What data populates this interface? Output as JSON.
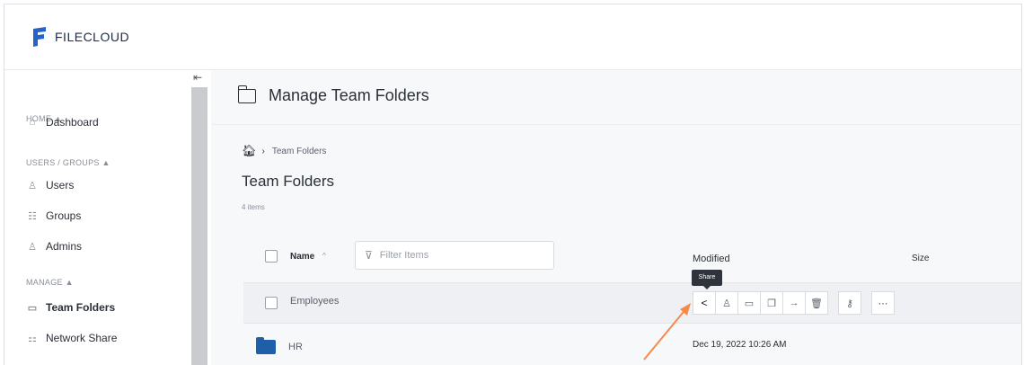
{
  "app": {
    "name": "FILECLOUD",
    "accent": "#2563c9",
    "arrow_color": "#f58a4a"
  },
  "sidebar": {
    "sections": [
      {
        "label": "HOME ▲"
      },
      {
        "label": "USERS / GROUPS ▲"
      },
      {
        "label": "MANAGE ▲"
      }
    ],
    "items": [
      {
        "label": "Dashboard",
        "icon": "home-icon"
      },
      {
        "label": "Users",
        "icon": "user-icon"
      },
      {
        "label": "Groups",
        "icon": "groups-icon"
      },
      {
        "label": "Admins",
        "icon": "admin-icon"
      },
      {
        "label": "Team Folders",
        "icon": "folder-icon",
        "active": true
      },
      {
        "label": "Network Share",
        "icon": "network-icon"
      }
    ]
  },
  "header": {
    "title": "Manage Team Folders"
  },
  "breadcrumb": {
    "current": "Team Folders"
  },
  "page": {
    "title": "Team Folders",
    "count": "4 items"
  },
  "table": {
    "name_header": "Name",
    "sort_indicator": "^",
    "filter_placeholder": "Filter Items",
    "modified_header": "Modified",
    "size_header": "Size",
    "rows": [
      {
        "name": "Employees",
        "modified": ""
      },
      {
        "name": "HR",
        "modified": "Dec 19, 2022 10:26 AM"
      }
    ]
  },
  "tooltip": {
    "text": "Share"
  },
  "actions": [
    "share-icon",
    "user-icon",
    "folder-move-icon",
    "copy-icon",
    "arrow-right-icon",
    "trash-icon",
    "key-icon",
    "more-icon"
  ]
}
